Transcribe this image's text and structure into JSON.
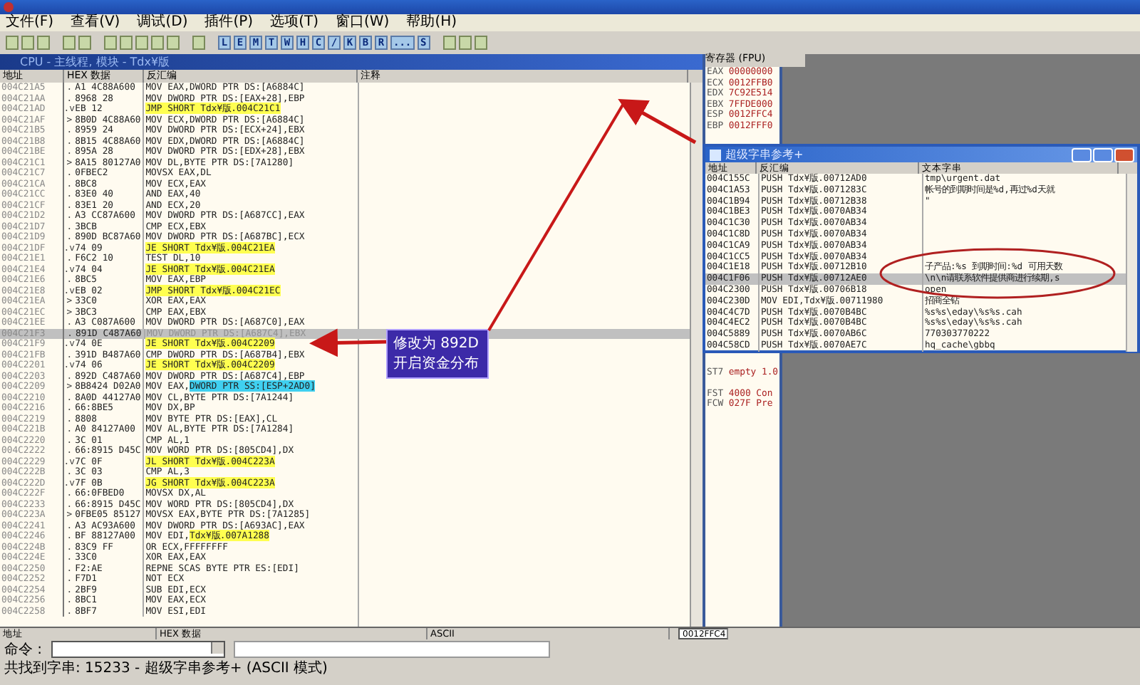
{
  "menu": [
    "文件(F)",
    "查看(V)",
    "调试(D)",
    "插件(P)",
    "选项(T)",
    "窗口(W)",
    "帮助(H)"
  ],
  "toolbar_letters": [
    "L",
    "E",
    "M",
    "T",
    "W",
    "H",
    "C",
    "/",
    "K",
    "B",
    "R",
    "...",
    "S"
  ],
  "cpu_window": {
    "title": "CPU - 主线程, 模块 - Tdx¥版",
    "columns": [
      "地址",
      "HEX 数据",
      "反汇编",
      "注释"
    ],
    "rows": [
      {
        "addr": "004C21A5",
        "mark": ".",
        "hex": "A1 4C88A600",
        "disasm": "MOV EAX,DWORD PTR DS:[A6884C]",
        "kind": "plain"
      },
      {
        "addr": "004C21AA",
        "mark": ".",
        "hex": "8968 28",
        "disasm": "MOV DWORD PTR DS:[EAX+28],EBP",
        "kind": "plain"
      },
      {
        "addr": "004C21AD",
        "mark": ".v",
        "hex": "EB 12",
        "disasm": "JMP SHORT Tdx¥版.004C21C1",
        "kind": "jump"
      },
      {
        "addr": "004C21AF",
        "mark": ">",
        "hex": "8B0D 4C88A60",
        "disasm": "MOV ECX,DWORD PTR DS:[A6884C]",
        "kind": "plain"
      },
      {
        "addr": "004C21B5",
        "mark": ".",
        "hex": "8959 24",
        "disasm": "MOV DWORD PTR DS:[ECX+24],EBX",
        "kind": "plain"
      },
      {
        "addr": "004C21B8",
        "mark": ".",
        "hex": "8B15 4C88A60",
        "disasm": "MOV EDX,DWORD PTR DS:[A6884C]",
        "kind": "plain"
      },
      {
        "addr": "004C21BE",
        "mark": ".",
        "hex": "895A 28",
        "disasm": "MOV DWORD PTR DS:[EDX+28],EBX",
        "kind": "plain"
      },
      {
        "addr": "004C21C1",
        "mark": ">",
        "hex": "8A15 80127A0",
        "disasm": "MOV DL,BYTE PTR DS:[7A1280]",
        "kind": "plain"
      },
      {
        "addr": "004C21C7",
        "mark": ".",
        "hex": "0FBEC2",
        "disasm": "MOVSX EAX,DL",
        "kind": "plain"
      },
      {
        "addr": "004C21CA",
        "mark": ".",
        "hex": "8BC8",
        "disasm": "MOV ECX,EAX",
        "kind": "plain"
      },
      {
        "addr": "004C21CC",
        "mark": ".",
        "hex": "83E0 40",
        "disasm": "AND EAX,40",
        "kind": "plain"
      },
      {
        "addr": "004C21CF",
        "mark": ".",
        "hex": "83E1 20",
        "disasm": "AND ECX,20",
        "kind": "plain"
      },
      {
        "addr": "004C21D2",
        "mark": ".",
        "hex": "A3 CC87A600",
        "disasm": "MOV DWORD PTR DS:[A687CC],EAX",
        "kind": "plain"
      },
      {
        "addr": "004C21D7",
        "mark": ".",
        "hex": "3BCB",
        "disasm": "CMP ECX,EBX",
        "kind": "plain"
      },
      {
        "addr": "004C21D9",
        "mark": ".",
        "hex": "890D BC87A60",
        "disasm": "MOV DWORD PTR DS:[A687BC],ECX",
        "kind": "plain"
      },
      {
        "addr": "004C21DF",
        "mark": ".v",
        "hex": "74 09",
        "disasm": "JE SHORT Tdx¥版.004C21EA",
        "kind": "jump"
      },
      {
        "addr": "004C21E1",
        "mark": ".",
        "hex": "F6C2 10",
        "disasm": "TEST DL,10",
        "kind": "plain"
      },
      {
        "addr": "004C21E4",
        "mark": ".v",
        "hex": "74 04",
        "disasm": "JE SHORT Tdx¥版.004C21EA",
        "kind": "jump"
      },
      {
        "addr": "004C21E6",
        "mark": ".",
        "hex": "8BC5",
        "disasm": "MOV EAX,EBP",
        "kind": "plain"
      },
      {
        "addr": "004C21E8",
        "mark": ".v",
        "hex": "EB 02",
        "disasm": "JMP SHORT Tdx¥版.004C21EC",
        "kind": "jump"
      },
      {
        "addr": "004C21EA",
        "mark": ">",
        "hex": "33C0",
        "disasm": "XOR EAX,EAX",
        "kind": "plain"
      },
      {
        "addr": "004C21EC",
        "mark": ">",
        "hex": "3BC3",
        "disasm": "CMP EAX,EBX",
        "kind": "plain"
      },
      {
        "addr": "004C21EE",
        "mark": ".",
        "hex": "A3 C087A600",
        "disasm": "MOV DWORD PTR DS:[A687C0],EAX",
        "kind": "plain"
      },
      {
        "addr": "004C21F3",
        "mark": ".",
        "hex": "891D C487A60",
        "disasm": "MOV DWORD PTR DS:[A687C4],EBX",
        "kind": "plain",
        "selected": true
      },
      {
        "addr": "004C21F9",
        "mark": ".v",
        "hex": "74 0E",
        "disasm": "JE SHORT Tdx¥版.004C2209",
        "kind": "jump"
      },
      {
        "addr": "004C21FB",
        "mark": ".",
        "hex": "391D B487A60",
        "disasm": "CMP DWORD PTR DS:[A687B4],EBX",
        "kind": "plain"
      },
      {
        "addr": "004C2201",
        "mark": ".v",
        "hex": "74 06",
        "disasm": "JE SHORT Tdx¥版.004C2209",
        "kind": "jump"
      },
      {
        "addr": "004C2203",
        "mark": ".",
        "hex": "892D C487A60",
        "disasm": "MOV DWORD PTR DS:[A687C4],EBP",
        "kind": "plain"
      },
      {
        "addr": "004C2209",
        "mark": ">",
        "hex": "8B8424 D02A0",
        "disasm": "MOV EAX,",
        "operand": {
          "text": "DWORD PTR SS:[ESP+2AD0]",
          "color": "#40d0f0"
        },
        "kind": "plain"
      },
      {
        "addr": "004C2210",
        "mark": ".",
        "hex": "8A0D 44127A0",
        "disasm": "MOV CL,BYTE PTR DS:[7A1244]",
        "kind": "plain"
      },
      {
        "addr": "004C2216",
        "mark": ".",
        "hex": "66:8BE5",
        "disasm": "MOV DX,BP",
        "kind": "plain"
      },
      {
        "addr": "004C2219",
        "mark": ".",
        "hex": "8808",
        "disasm": "MOV BYTE PTR DS:[EAX],CL",
        "kind": "plain"
      },
      {
        "addr": "004C221B",
        "mark": ".",
        "hex": "A0 84127A00",
        "disasm": "MOV AL,BYTE PTR DS:[7A1284]",
        "kind": "plain"
      },
      {
        "addr": "004C2220",
        "mark": ".",
        "hex": "3C 01",
        "disasm": "CMP AL,1",
        "kind": "plain"
      },
      {
        "addr": "004C2222",
        "mark": ".",
        "hex": "66:8915 D45C",
        "disasm": "MOV WORD PTR DS:[805CD4],DX",
        "kind": "plain"
      },
      {
        "addr": "004C2229",
        "mark": ".v",
        "hex": "7C 0F",
        "disasm": "JL SHORT Tdx¥版.004C223A",
        "kind": "jump"
      },
      {
        "addr": "004C222B",
        "mark": ".",
        "hex": "3C 03",
        "disasm": "CMP AL,3",
        "kind": "plain"
      },
      {
        "addr": "004C222D",
        "mark": ".v",
        "hex": "7F 0B",
        "disasm": "JG SHORT Tdx¥版.004C223A",
        "kind": "jump"
      },
      {
        "addr": "004C222F",
        "mark": ".",
        "hex": "66:0FBED0",
        "disasm": "MOVSX DX,AL",
        "kind": "plain"
      },
      {
        "addr": "004C2233",
        "mark": ".",
        "hex": "66:8915 D45C",
        "disasm": "MOV WORD PTR DS:[805CD4],DX",
        "kind": "plain"
      },
      {
        "addr": "004C223A",
        "mark": ">",
        "hex": "0FBE05 85127",
        "disasm": "MOVSX EAX,BYTE PTR DS:[7A1285]",
        "kind": "plain"
      },
      {
        "addr": "004C2241",
        "mark": ".",
        "hex": "A3 AC93A600",
        "disasm": "MOV DWORD PTR DS:[A693AC],EAX",
        "kind": "plain"
      },
      {
        "addr": "004C2246",
        "mark": ".",
        "hex": "BF 88127A00",
        "disasm": "MOV EDI,",
        "operand": {
          "text": "Tdx¥版.007A1288",
          "color": "#ffff50"
        },
        "kind": "plain"
      },
      {
        "addr": "004C224B",
        "mark": ".",
        "hex": "83C9 FF",
        "disasm": "OR ECX,FFFFFFFF",
        "kind": "plain"
      },
      {
        "addr": "004C224E",
        "mark": ".",
        "hex": "33C0",
        "disasm": "XOR EAX,EAX",
        "kind": "plain"
      },
      {
        "addr": "004C2250",
        "mark": ".",
        "hex": "F2:AE",
        "disasm": "REPNE SCAS BYTE PTR ES:[EDI]",
        "kind": "plain"
      },
      {
        "addr": "004C2252",
        "mark": ".",
        "hex": "F7D1",
        "disasm": "NOT ECX",
        "kind": "plain"
      },
      {
        "addr": "004C2254",
        "mark": ".",
        "hex": "2BF9",
        "disasm": "SUB EDI,ECX",
        "kind": "plain"
      },
      {
        "addr": "004C2256",
        "mark": ".",
        "hex": "8BC1",
        "disasm": "MOV EAX,ECX",
        "kind": "plain"
      },
      {
        "addr": "004C2258",
        "mark": ".",
        "hex": "8BF7",
        "disasm": "MOV ESI,EDI",
        "kind": "plain"
      }
    ]
  },
  "registers": {
    "header": "寄存器 (FPU)",
    "rows": [
      {
        "name": "EAX",
        "value": "00000000"
      },
      {
        "name": "ECX",
        "value": "0012FFB0"
      },
      {
        "name": "EDX",
        "value": "7C92E514"
      },
      {
        "name": "EBX",
        "value": "7FFDE000"
      },
      {
        "name": "ESP",
        "value": "0012FFC4"
      },
      {
        "name": "EBP",
        "value": "0012FFF0"
      }
    ],
    "fpu_rows": [
      {
        "name": "ST7",
        "value": "empty 1.0"
      },
      {
        "name": "FST",
        "value": "4000 Con"
      },
      {
        "name": "FCW",
        "value": "027F Pre"
      }
    ]
  },
  "strings_window": {
    "title": "超级字串参考+",
    "columns": [
      "地址",
      "反汇编",
      "文本字串"
    ],
    "rows": [
      {
        "addr": "004C155C",
        "disasm": "PUSH Tdx¥版.00712AD0",
        "text": "tmp\\urgent.dat",
        "selected": false
      },
      {
        "addr": "004C1A53",
        "disasm": "PUSH Tdx¥版.0071283C",
        "text": "帐号的到期时间是%d,再过%d天就",
        "selected": false
      },
      {
        "addr": "004C1B94",
        "disasm": "PUSH Tdx¥版.00712B38",
        "text": "\"",
        "selected": false
      },
      {
        "addr": "004C1BE3",
        "disasm": "PUSH Tdx¥版.0070AB34",
        "selected": false
      },
      {
        "addr": "004C1C30",
        "disasm": "PUSH Tdx¥版.0070AB34",
        "selected": false
      },
      {
        "addr": "004C1C8D",
        "disasm": "PUSH Tdx¥版.0070AB34",
        "selected": false
      },
      {
        "addr": "004C1CA9",
        "disasm": "PUSH Tdx¥版.0070AB34",
        "selected": false
      },
      {
        "addr": "004C1CC5",
        "disasm": "PUSH Tdx¥版.0070AB34",
        "selected": false
      },
      {
        "addr": "004C1E18",
        "disasm": "PUSH Tdx¥版.00712B10",
        "text": "子产品:%s 到期时间:%d 可用天数",
        "selected": false
      },
      {
        "addr": "004C1F06",
        "disasm": "PUSH Tdx¥版.00712AE0",
        "text": "\\n\\n请联系软件提供商进行续期,s",
        "selected": true
      },
      {
        "addr": "004C2300",
        "disasm": "PUSH Tdx¥版.00706B18",
        "text": "open",
        "selected": false
      },
      {
        "addr": "004C230D",
        "disasm": "MOV EDI,Tdx¥版.00711980",
        "text": "招商全钻",
        "selected": false
      },
      {
        "addr": "004C4C7D",
        "disasm": "PUSH Tdx¥版.0070B4BC",
        "text": "%s%s\\eday\\%s%s.cah",
        "selected": false
      },
      {
        "addr": "004C4EC2",
        "disasm": "PUSH Tdx¥版.0070B4BC",
        "text": "%s%s\\eday\\%s%s.cah",
        "selected": false
      },
      {
        "addr": "004C5889",
        "disasm": "PUSH Tdx¥版.0070AB6C",
        "text": "770303770222",
        "selected": false
      },
      {
        "addr": "004C58CD",
        "disasm": "PUSH Tdx¥版.0070AE7C",
        "text": "hq_cache\\gbbq",
        "selected": false
      }
    ]
  },
  "dump": {
    "columns": [
      "地址",
      "HEX 数据",
      "ASCII"
    ],
    "stack_value": "0012FFC4"
  },
  "command": {
    "label": "命令 :"
  },
  "status_bar": "共找到字串: 15233 - 超级字串参考+ (ASCII 模式)",
  "annotation": {
    "lines": [
      "修改为 892D",
      "开启资金分布"
    ]
  }
}
